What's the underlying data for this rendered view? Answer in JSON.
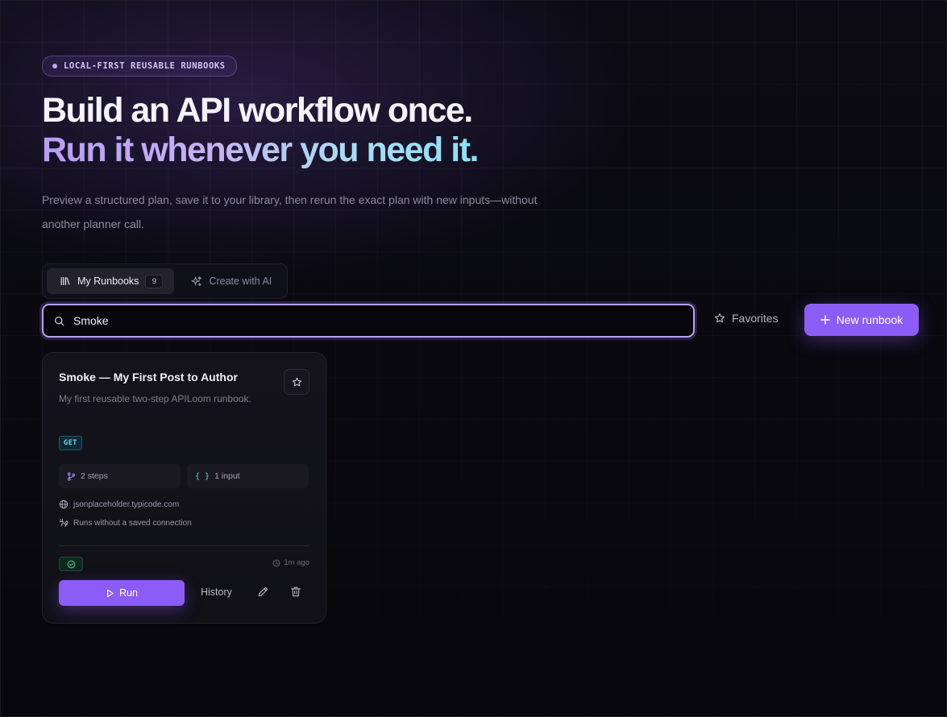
{
  "hero": {
    "eyebrow": "LOCAL-FIRST REUSABLE RUNBOOKS",
    "title_line1": "Build an API workflow once.",
    "title_line2": "Run it whenever you need it.",
    "subtitle": "Preview a structured plan, save it to your library, then rerun the exact plan with new inputs—without another planner call."
  },
  "tabs": [
    {
      "label": "My Runbooks",
      "count": "9",
      "icon": "library-icon",
      "active": true
    },
    {
      "label": "Create with AI",
      "icon": "sparkles-icon",
      "active": false
    }
  ],
  "toolbar": {
    "search_value": "Smoke",
    "favorites_label": "Favorites",
    "new_label": "New runbook"
  },
  "cards": [
    {
      "title": "Smoke — My First Post to Author",
      "description": "My first reusable two-step APILoom runbook.",
      "method": "GET",
      "steps": "2 steps",
      "inputs": "1 input",
      "host": "jsonplaceholder.typicode.com",
      "connection": "Runs without a saved connection",
      "updated": "1m ago",
      "run_label": "Run",
      "history_label": "History"
    }
  ],
  "colors": {
    "accent": "#8b5cf6",
    "background": "#0a0a10",
    "method_get": "#7fd6ec",
    "success": "#3fbf86"
  }
}
